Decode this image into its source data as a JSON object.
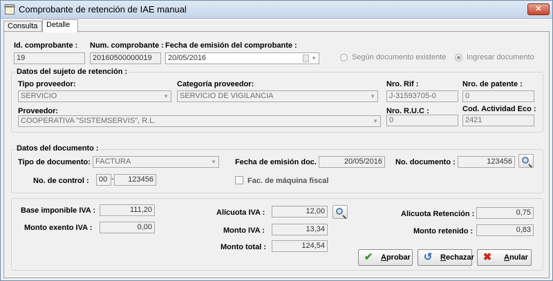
{
  "window": {
    "title": "Comprobante de retención de IAE manual",
    "close": "✕"
  },
  "tabs": [
    "Consulta",
    "Detalle"
  ],
  "header": {
    "id_label": "Id. comprobante :",
    "id_value": "19",
    "num_label": "Num. comprobante :",
    "num_value": "20160500000019",
    "fecha_label": "Fecha de emisión del comprobante :",
    "fecha_value": "20/05/2016",
    "radio_existente": "Según documento existente",
    "radio_ingresar": "Ingresar documento"
  },
  "sujeto": {
    "title": "Datos del sujeto de retención :",
    "tipo_label": "Tipo proveedor:",
    "tipo_value": "SERVICIO",
    "cat_label": "Categoría proveedor:",
    "cat_value": "SERVICIO DE VIGILANCIA",
    "rif_label": "Nro. Rif :",
    "rif_value": "J-31593705-0",
    "patente_label": "Nro. de patente :",
    "patente_value": "0",
    "prov_label": "Proveedor:",
    "prov_value": "COOPERATIVA \"SISTEMSERVIS\", R.L.",
    "ruc_label": "Nro. R.U.C :",
    "ruc_value": "0",
    "cod_label": "Cod. Actividad Eco :",
    "cod_value": "2421"
  },
  "documento": {
    "title": "Datos del documento :",
    "tipo_label": "Tipo de documento:",
    "tipo_value": "FACTURA",
    "fecha_label": "Fecha de emisión doc. :",
    "fecha_value": "20/05/2016",
    "nodoc_label": "No. documento :",
    "nodoc_value": "123456",
    "control_label": "No. de control :",
    "control_prefix": "00",
    "control_sep": "-",
    "control_value": "123456",
    "fiscal_label": "Fac. de máquina fiscal"
  },
  "montos": {
    "base_label": "Base imponible IVA :",
    "base_value": "111,20",
    "exento_label": "Monto exento IVA :",
    "exento_value": "0,00",
    "alicuota_label": "Alícuota IVA :",
    "alicuota_value": "12,00",
    "montoiva_label": "Monto IVA :",
    "montoiva_value": "13,34",
    "total_label": "Monto total :",
    "total_value": "124,54",
    "alret_label": "Alicuota Retención :",
    "alret_value": "0,75",
    "retenido_label": "Monto retenido :",
    "retenido_value": "0,83"
  },
  "buttons": {
    "aprobar_u": "A",
    "aprobar_rest": "probar",
    "rechazar_u": "R",
    "rechazar_rest": "echazar",
    "anular_u": "A",
    "anular_rest": "nular"
  },
  "colors": {
    "aprobar_icon": "#3a9a2a",
    "rechazar_icon": "#2a6ac0",
    "anular_icon": "#d2241c"
  }
}
